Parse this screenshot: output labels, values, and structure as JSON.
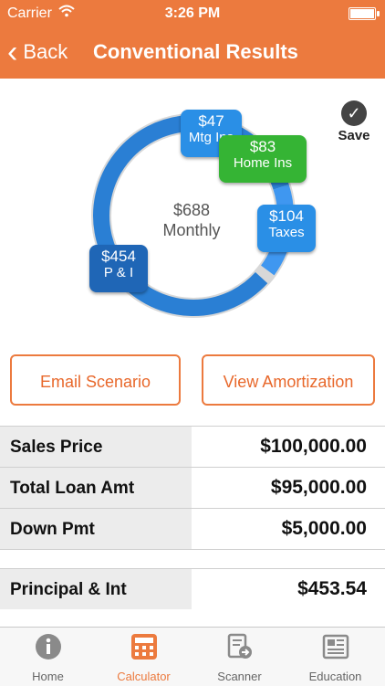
{
  "status": {
    "carrier": "Carrier",
    "time": "3:26 PM"
  },
  "nav": {
    "back_label": "Back",
    "title": "Conventional Results"
  },
  "summary": {
    "monthly_amount": "$688",
    "monthly_label": "Monthly",
    "segments": [
      {
        "amount": "$454",
        "label": "P & I",
        "color": "#1f66b6",
        "value": 454
      },
      {
        "amount": "$104",
        "label": "Taxes",
        "color": "#2a8fe6",
        "value": 104
      },
      {
        "amount": "$83",
        "label": "Home Ins",
        "color": "#35b434",
        "value": 83
      },
      {
        "amount": "$47",
        "label": "Mtg Ins",
        "color": "#2a8fe6",
        "value": 47
      }
    ]
  },
  "save_label": "Save",
  "buttons": {
    "email": "Email Scenario",
    "amortization": "View Amortization"
  },
  "rows": [
    {
      "label": "Sales Price",
      "value": "$100,000.00"
    },
    {
      "label": "Total Loan Amt",
      "value": "$95,000.00"
    },
    {
      "label": "Down Pmt",
      "value": "$5,000.00"
    },
    {
      "label": "Principal & Int",
      "value": "$453.54"
    }
  ],
  "tabs": [
    {
      "label": "Home",
      "icon": "info-icon"
    },
    {
      "label": "Calculator",
      "icon": "calculator-icon"
    },
    {
      "label": "Scanner",
      "icon": "scanner-icon"
    },
    {
      "label": "Education",
      "icon": "newspaper-icon"
    }
  ],
  "colors": {
    "accent": "#ec7a3e",
    "donut_main": "#2a7fd4"
  }
}
